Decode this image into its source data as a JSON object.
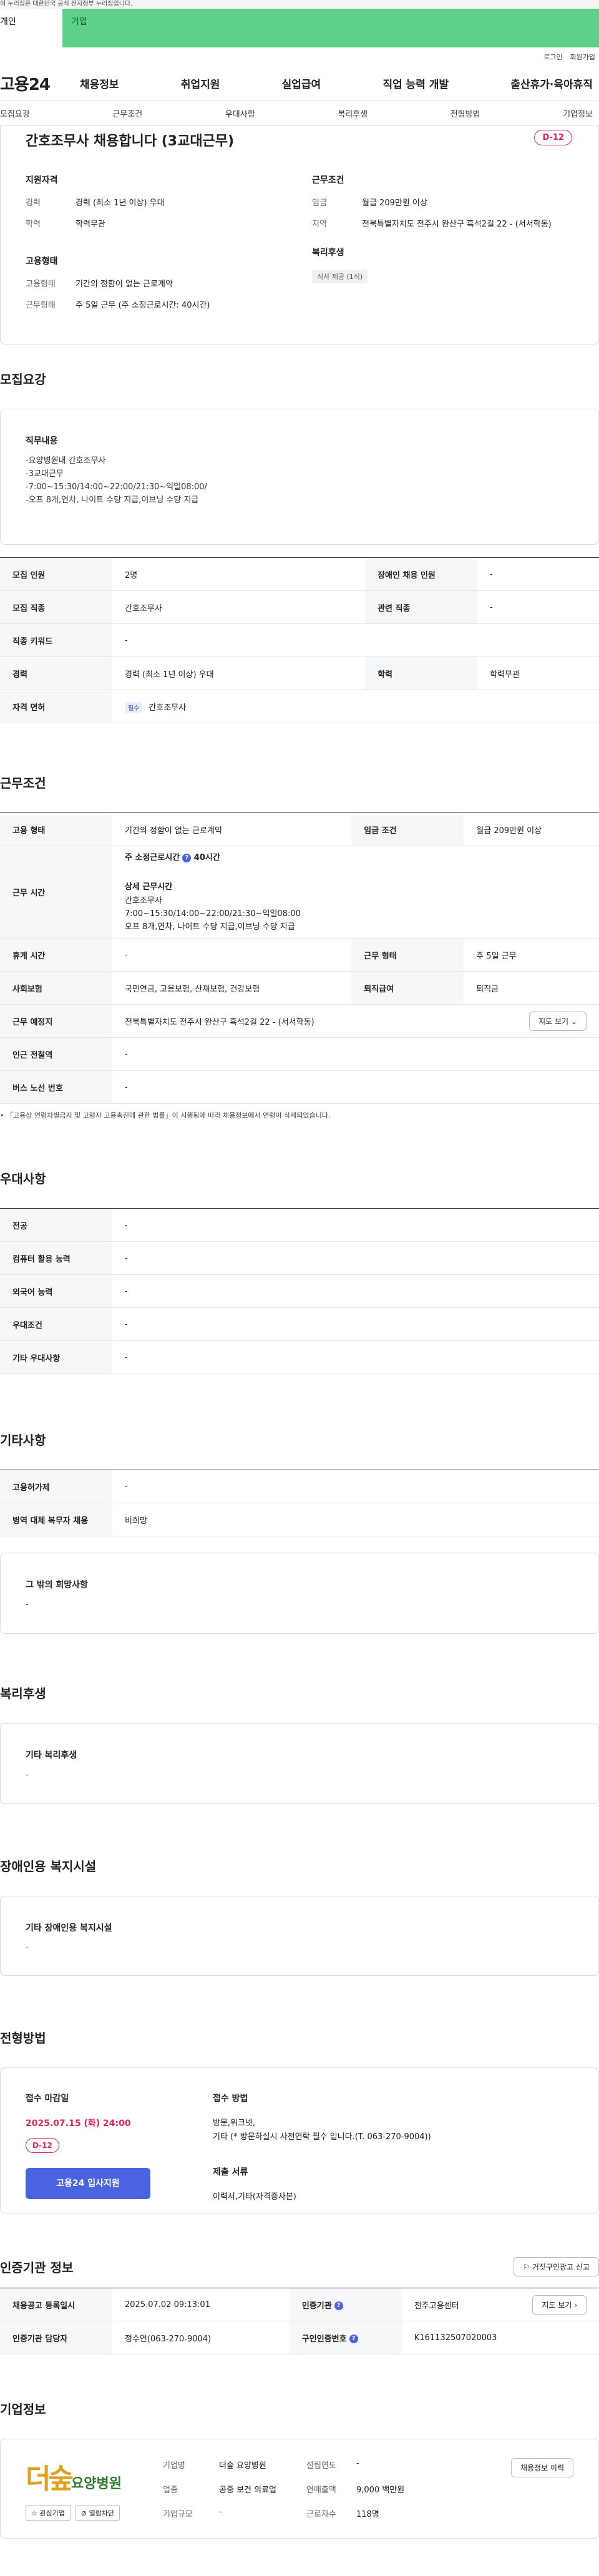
{
  "gov_banner": "이 누리집은 대한민국 공식 전자정부 누리집입니다.",
  "top_tabs": [
    "개인",
    "기업"
  ],
  "util": [
    "로그인",
    "회원가입"
  ],
  "brand": "고용24",
  "gnb": [
    "채용정보",
    "취업지원",
    "실업급여",
    "직업 능력 개발",
    "출산휴가·육아휴직"
  ],
  "subnav": [
    "모집요강",
    "근무조건",
    "우대사항",
    "복리후생",
    "전형방법",
    "기업정보"
  ],
  "summary": {
    "title": "간호조무사 채용합니다 (3교대근무)",
    "dday": "D-12",
    "qual_title": "지원자격",
    "qual": [
      {
        "k": "경력",
        "v": "경력 (최소 1년 이상) 우대"
      },
      {
        "k": "학력",
        "v": "학력무관"
      }
    ],
    "emp_title": "고용형태",
    "emp": [
      {
        "k": "고용형태",
        "v": "기간의 정함이 없는 근로계약"
      },
      {
        "k": "근무형태",
        "v": "주 5일 근무 (주 소정근로시간: 40시간)"
      }
    ],
    "cond_title": "근무조건",
    "cond": [
      {
        "k": "임금",
        "v": "월급 209만원 이상"
      },
      {
        "k": "지역",
        "v": "전북특별자치도 전주시 완산구 흑석2길 22 - (서서학동)"
      }
    ],
    "welfare_title": "복리후생",
    "welfare_chip": "식사 제공 (1식)"
  },
  "recruit": {
    "title": "모집요강",
    "duty_title": "직무내용",
    "duty_text": "-요양병원내 간호조무사\n-3교대근무\n-7:00~15:30/14:00~22:00/21:30~익일08:00/\n-오프 8개,연차, 나이트 수당 지급,이브닝 수당 지급",
    "rows": [
      {
        "k1": "모집 인원",
        "v1": "2명",
        "k2": "장애인 채용 인원",
        "v2": "-"
      },
      {
        "k1": "모집 직종",
        "v1": "간호조무사",
        "k2": "관련 직종",
        "v2": "-"
      },
      {
        "k1": "직종 키워드",
        "v1": "-"
      },
      {
        "k1": "경력",
        "v1": "경력 (최소 1년 이상) 우대",
        "k2": "학력",
        "v2": "학력무관"
      }
    ],
    "license_k": "자격 면허",
    "license_chip": "필수",
    "license_v": "간호조무사"
  },
  "work": {
    "title": "근무조건",
    "emp_k": "고용 형태",
    "emp_v": "기간의 정함이 없는 근로계약",
    "wage_k": "임금 조건",
    "wage_v": "월급 209만원 이상",
    "time_k": "근무 시간",
    "time_main": "주 소정근로시간",
    "time_hours": "40시간",
    "time_detail_title": "상세 근무시간",
    "time_detail": "간호조무사\n7:00~15:30/14:00~22:00/21:30~익일08:00\n오프 8개,연차, 나이트 수당 지급,이브닝 수당 지급",
    "rest_k": "휴게 시간",
    "rest_v": "-",
    "form_k": "근무 형태",
    "form_v": "주 5일 근무",
    "ins_k": "사회보험",
    "ins_v": "국민연금, 고용보험, 산재보험, 건강보험",
    "sev_k": "퇴직급여",
    "sev_v": "퇴직금",
    "place_k": "근무 예정지",
    "place_v": "전북특별자치도 전주시 완산구 흑석2길 22 - (서서학동)",
    "map_btn": "지도 보기",
    "subway_k": "인근 전철역",
    "subway_v": "-",
    "bus_k": "버스 노선 번호",
    "bus_v": "-",
    "note": "「고용상 연령차별금지 및 고령자 고용촉진에 관한 법률」이 시행됨에 따라 채용정보에서 연령이 삭제되었습니다."
  },
  "pref": {
    "title": "우대사항",
    "rows": [
      {
        "k": "전공",
        "v": "-"
      },
      {
        "k": "컴퓨터 활용 능력",
        "v": "-"
      },
      {
        "k": "외국어 능력",
        "v": "-"
      },
      {
        "k": "우대조건",
        "v": "-"
      },
      {
        "k": "기타 우대사항",
        "v": "-"
      }
    ]
  },
  "etc": {
    "title": "기타사항",
    "rows": [
      {
        "k": "고용허가제",
        "v": "-"
      },
      {
        "k": "병역 대체 복무자 채용",
        "v": "비희망"
      }
    ],
    "box_title": "그 밖의 희망사항",
    "box_v": "-"
  },
  "welfare": {
    "title": "복리후생",
    "box_title": "기타 복리후생",
    "box_v": "-"
  },
  "disab": {
    "title": "장애인용 복지시설",
    "box_title": "기타 장애인용 복지시설",
    "box_v": "-"
  },
  "apply": {
    "title": "전형방법",
    "deadline_title": "접수 마감일",
    "deadline": "2025.07.15 (화) 24:00",
    "dday": "D-12",
    "apply_btn": "고용24 입사지원",
    "method_title": "접수 방법",
    "method": "방문,워크넷,\n기타 (* 방문하실시 사전연락 필수 입니다.(T. 063-270-9004))",
    "docs_title": "제출 서류",
    "docs": "이력서,기타(자격증사본)"
  },
  "cert": {
    "title": "인증기관 정보",
    "report_btn": "거짓구인광고 신고",
    "r1": {
      "k1": "채용공고 등록일시",
      "v1": "2025.07.02 09:13:01",
      "k2": "인증기관",
      "v2": "전주고용센터",
      "btn": "지도 보기"
    },
    "r2": {
      "k1": "인증기관 담당자",
      "v1": "정수연(063-270-9004)",
      "k2": "구인인증번호",
      "v2": "K161132507020003"
    },
    "q": "?"
  },
  "company": {
    "title": "기업정보",
    "logo_text": "더숲",
    "logo_sub": "요양병원",
    "fav_btn": "관심기업",
    "block_btn": "열람차단",
    "history_btn": "채용정보 이력",
    "rows": [
      {
        "k": "기업명",
        "v": "더숲 요양병원",
        "k2": "설립연도",
        "v2": "-"
      },
      {
        "k": "업종",
        "v": "공중 보건 의료업",
        "k2": "연매출액",
        "v2": "9,000 백만원"
      },
      {
        "k": "기업규모",
        "v": "-",
        "k2": "근로자수",
        "v2": "118명"
      }
    ]
  }
}
